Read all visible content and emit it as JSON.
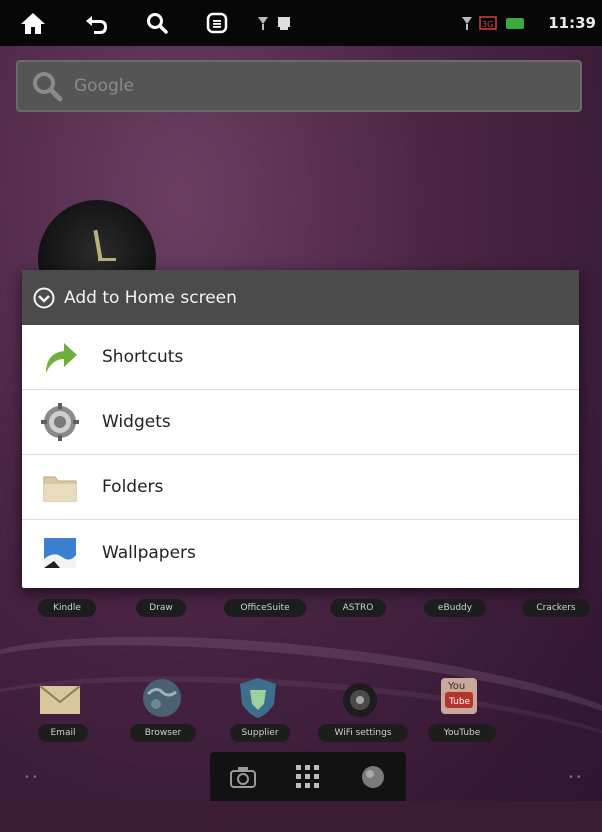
{
  "status_bar": {
    "time": "11:39",
    "icons": [
      "home-icon",
      "back-icon",
      "search-icon",
      "menu-icon",
      "notification-icon",
      "signal-icon",
      "3g-icon",
      "battery-icon"
    ]
  },
  "search_bar": {
    "placeholder": "Google",
    "icon": "search-icon"
  },
  "dialog": {
    "title": "Add to Home screen",
    "items": [
      {
        "label": "Shortcuts",
        "icon": "shortcut-arrow-icon"
      },
      {
        "label": "Widgets",
        "icon": "widgets-gear-icon"
      },
      {
        "label": "Folders",
        "icon": "folder-icon"
      },
      {
        "label": "Wallpapers",
        "icon": "wallpaper-icon"
      }
    ]
  },
  "apps_row1": [
    {
      "label": "Kindle"
    },
    {
      "label": "Draw"
    },
    {
      "label": "OfficeSuite"
    },
    {
      "label": "ASTRO"
    },
    {
      "label": "eBuddy"
    },
    {
      "label": "Crackers"
    }
  ],
  "apps_row2": [
    {
      "label": "Email",
      "icon": "email-icon"
    },
    {
      "label": "Browser",
      "icon": "browser-globe-icon"
    },
    {
      "label": "Supplier",
      "icon": "shield-icon"
    },
    {
      "label": "WiFi settings",
      "icon": "wifi-settings-icon"
    },
    {
      "label": "YouTube",
      "icon": "youtube-icon"
    }
  ],
  "dock": [
    "camera-icon",
    "apps-grid-icon",
    "browser-icon"
  ],
  "colors": {
    "dialog_header": "#4b4b4b",
    "wallpaper": "#4a2444",
    "status_bar": "#070707"
  }
}
